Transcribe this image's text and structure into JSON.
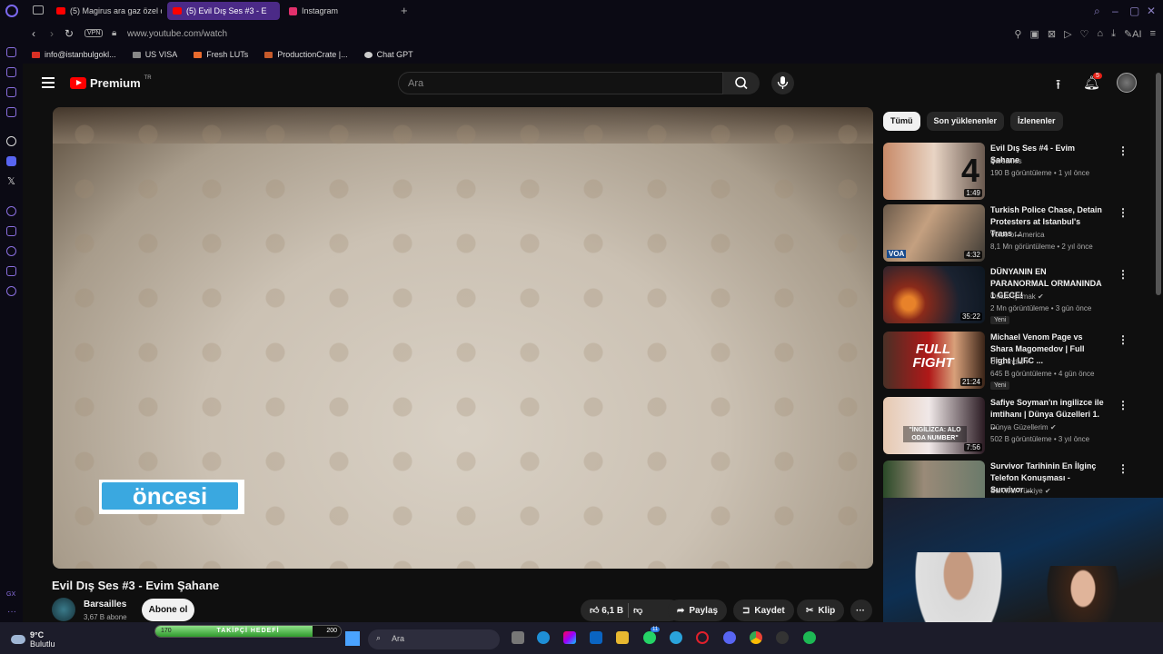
{
  "browser": {
    "tabs": [
      {
        "label": "(5) Magirus ara gaz özel d",
        "active": false,
        "favicon_color": "#ff0000"
      },
      {
        "label": "(5) Evil Dış Ses #3 - E",
        "active": true,
        "favicon_color": "#ff0000"
      },
      {
        "label": "Instagram",
        "active": false,
        "favicon_color": "#e1306c"
      }
    ],
    "new_tab": "+",
    "vpn": "VPN",
    "url": "www.youtube.com/watch",
    "ai_label": "AI",
    "bookmarks": [
      {
        "label": "info@istanbulgokl...",
        "color": "#d93025"
      },
      {
        "label": "US VISA",
        "color": "#888888"
      },
      {
        "label": "Fresh LUTs",
        "color": "#e86b2e"
      },
      {
        "label": "ProductionCrate |...",
        "color": "#c65a2b"
      },
      {
        "label": "Chat GPT",
        "color": "#cccccc"
      }
    ],
    "sidebar_gx": "GX"
  },
  "youtube": {
    "logo_text": "Premium",
    "logo_region": "TR",
    "search_placeholder": "Ara",
    "notification_count": "5",
    "video": {
      "overlay_text": "öncesi",
      "title": "Evil Dış Ses #3 - Evim Şahane",
      "channel": "Barsailles",
      "subscribers": "3,67 B abone",
      "subscribe_label": "Abone ol",
      "likes": "6,1 B",
      "share_label": "Paylaş",
      "save_label": "Kaydet",
      "clip_label": "Klip"
    },
    "chips": [
      {
        "label": "Tümü",
        "selected": true
      },
      {
        "label": "Son yüklenenler",
        "selected": false
      },
      {
        "label": "İzlenenler",
        "selected": false
      }
    ],
    "recommendations": [
      {
        "title": "Evil Dış Ses #4 - Evim Şahane",
        "channel": "Barsailles",
        "verified": false,
        "meta": "190 B görüntüleme • 1 yıl önce",
        "duration": "1:49",
        "thumb_text": "4",
        "new": false
      },
      {
        "title": "Turkish Police Chase, Detain Protesters at Istanbul's Trans ...",
        "channel": "Voice of America",
        "verified": false,
        "meta": "8,1 Mn görüntüleme • 2 yıl önce",
        "duration": "4:32",
        "thumb_text": "VOA",
        "new": false
      },
      {
        "title": "DÜNYANIN EN PARANORMAL ORMANINDA 1 GECE!",
        "channel": "Orkun Işıtmak",
        "verified": true,
        "meta": "2 Mn görüntüleme • 3 gün önce",
        "duration": "35:22",
        "thumb_text": "",
        "new": true
      },
      {
        "title": "Michael Venom Page vs Shara Magomedov | Full Fight | UFC ...",
        "channel": "UFC India",
        "verified": true,
        "meta": "645 B görüntüleme • 4 gün önce",
        "duration": "21:24",
        "thumb_text": "FULL FIGHT",
        "new": true
      },
      {
        "title": "Safiye Soyman'ın ingilizce ile imtihanı | Dünya Güzelleri 1. ...",
        "channel": "Dünya Güzellerim",
        "verified": true,
        "meta": "502 B görüntüleme • 3 yıl önce",
        "duration": "7:56",
        "thumb_text": "\"İNGİLİZCA: ALO ODA NUMBER\"",
        "new": false
      },
      {
        "title": "Survivor Tarihinin En İlginç Telefon Konuşması - Survivor ...",
        "channel": "Survivor Türkiye",
        "verified": true,
        "meta": "",
        "duration": "",
        "thumb_text": "",
        "new": false
      }
    ],
    "new_badge": "Yeni"
  },
  "taskbar": {
    "temperature": "9°C",
    "condition": "Bulutlu",
    "follower_goal": {
      "label": "TAKİPÇİ HEDEFİ",
      "current": "170",
      "target": "200",
      "progress": 0.85
    },
    "search_placeholder": "Ara",
    "whatsapp_badge": "11"
  }
}
